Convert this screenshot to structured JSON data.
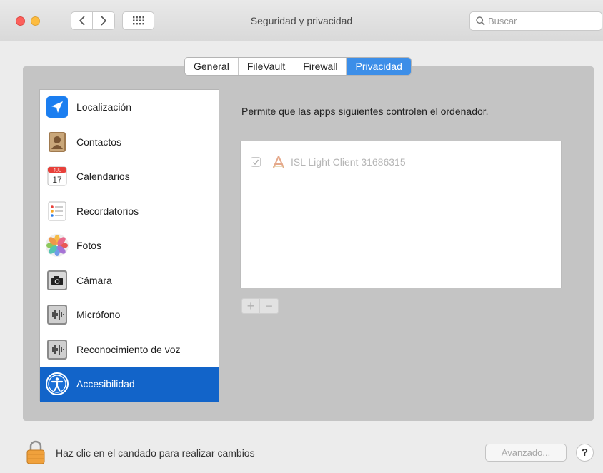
{
  "window": {
    "title": "Seguridad y privacidad",
    "search_placeholder": "Buscar"
  },
  "tabs": [
    {
      "label": "General",
      "active": false
    },
    {
      "label": "FileVault",
      "active": false
    },
    {
      "label": "Firewall",
      "active": false
    },
    {
      "label": "Privacidad",
      "active": true
    }
  ],
  "sidebar": {
    "items": [
      {
        "label": "Localización",
        "icon": "location-icon"
      },
      {
        "label": "Contactos",
        "icon": "contacts-icon"
      },
      {
        "label": "Calendarios",
        "icon": "calendar-icon",
        "calendar_month": "JUL",
        "calendar_day": "17"
      },
      {
        "label": "Recordatorios",
        "icon": "reminders-icon"
      },
      {
        "label": "Fotos",
        "icon": "photos-icon"
      },
      {
        "label": "Cámara",
        "icon": "camera-icon"
      },
      {
        "label": "Micrófono",
        "icon": "microphone-icon"
      },
      {
        "label": "Reconocimiento de voz",
        "icon": "speech-recognition-icon"
      },
      {
        "label": "Accesibilidad",
        "icon": "accessibility-icon",
        "selected": true
      }
    ]
  },
  "content": {
    "description": "Permite que las apps siguientes controlen el ordenador.",
    "apps": [
      {
        "name": "ISL Light Client 31686315",
        "checked": true
      }
    ],
    "add_label": "+",
    "remove_label": "−"
  },
  "footer": {
    "lock_text": "Haz clic en el candado para realizar cambios",
    "advanced_label": "Avanzado...",
    "help_label": "?"
  },
  "colors": {
    "accent": "#1264c9",
    "tab_active": "#3c8ee8",
    "panel": "#c4c4c4"
  }
}
